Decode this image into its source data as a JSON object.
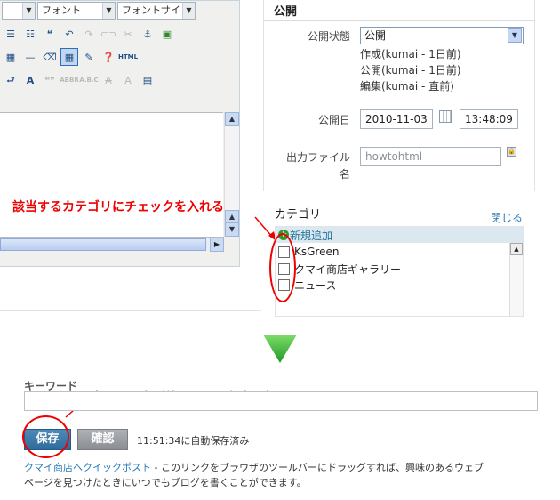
{
  "toolbar": {
    "font_family": "フォント",
    "font_size": "フォントサイ",
    "html_button": "HTML"
  },
  "publish": {
    "title": "公開",
    "status_label": "公開状態",
    "status_value": "公開",
    "history": [
      "作成(kumai - 1日前)",
      "公開(kumai - 1日前)",
      "編集(kumai - 直前)"
    ],
    "date_label": "公開日",
    "date_value": "2010-11-03",
    "time_value": "13:48:09",
    "file_label_1": "出力ファイル",
    "file_label_2": "名",
    "file_value": "howtohtml"
  },
  "category": {
    "title": "カテゴリ",
    "close": "閉じる",
    "add_new": "新規追加",
    "items": [
      "KsGreen",
      "クマイ商店ギャラリー",
      "ニュース"
    ]
  },
  "annotations": {
    "category_note": "該当するカテゴリにチェックを入れる",
    "save_note": "全ての入力が終ったら、保存を押す。"
  },
  "keyword": {
    "label": "キーワード",
    "value": ""
  },
  "actions": {
    "save": "保存",
    "preview": "確認",
    "autosave_status": "11:51:34に自動保存済み"
  },
  "quickpost": {
    "link": "クマイ商店へクイックポスト",
    "text_line1": " - このリンクをブラウザのツールバーにドラッグすれば、興味のあるウェブ",
    "text_line2": "ページを見つけたときにいつでもブログを書くことができます。"
  },
  "colors": {
    "annotation": "#ee0000",
    "accent_arrow": "#33b533",
    "save_button": "#2e6c9c",
    "link": "#2a7ab7"
  }
}
